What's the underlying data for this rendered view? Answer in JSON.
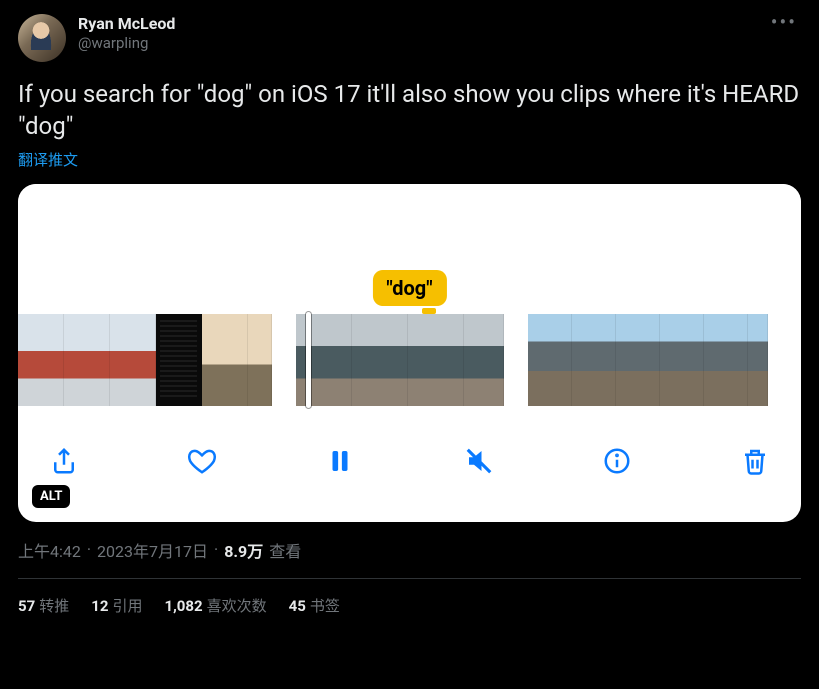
{
  "author": {
    "display_name": "Ryan McLeod",
    "handle": "@warpling"
  },
  "tweet_text": "If you search for \"dog\" on iOS 17 it'll also show you clips where it's HEARD \"dog\"",
  "translate_label": "翻译推文",
  "media": {
    "tooltip_text": "\"dog\"",
    "alt_badge": "ALT"
  },
  "meta": {
    "time": "上午4:42",
    "separator": " · ",
    "date": "2023年7月17日",
    "views_count": "8.9万",
    "views_label": "查看"
  },
  "stats": {
    "retweets_count": "57",
    "retweets_label": "转推",
    "quotes_count": "12",
    "quotes_label": "引用",
    "likes_count": "1,082",
    "likes_label": "喜欢次数",
    "bookmarks_count": "45",
    "bookmarks_label": "书签"
  },
  "menu_dots": "•••"
}
